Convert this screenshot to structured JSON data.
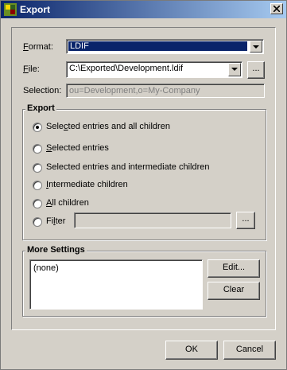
{
  "window": {
    "title": "Export"
  },
  "format": {
    "label_accel": "F",
    "label_rest": "ormat:",
    "value": "LDIF"
  },
  "file": {
    "label_accel": "F",
    "label_rest": "ile:",
    "value": "C:\\Exported\\Development.ldif",
    "browse": "..."
  },
  "selection": {
    "label": "Selection:",
    "value": "ou=Development,o=My-Company"
  },
  "export_group": {
    "title": "Export",
    "options": [
      {
        "pre": "Sele",
        "accel": "c",
        "post": "ted entries and all children",
        "selected": true
      },
      {
        "pre": "",
        "accel": "S",
        "post": "elected entries",
        "selected": false
      },
      {
        "pre": "Selected entries and ",
        "accel": "",
        "post": "intermediate children",
        "selected": false
      },
      {
        "pre": "",
        "accel": "I",
        "post": "ntermediate children",
        "selected": false
      },
      {
        "pre": "",
        "accel": "A",
        "post": "ll children",
        "selected": false
      },
      {
        "pre": "Fi",
        "accel": "l",
        "post": "ter",
        "selected": false
      }
    ],
    "filter_value": "",
    "filter_browse": "..."
  },
  "more_settings": {
    "title": "More Settings",
    "items": [
      "(none)"
    ],
    "edit": "Edit...",
    "clear": "Clear"
  },
  "buttons": {
    "ok": "OK",
    "cancel": "Cancel"
  }
}
